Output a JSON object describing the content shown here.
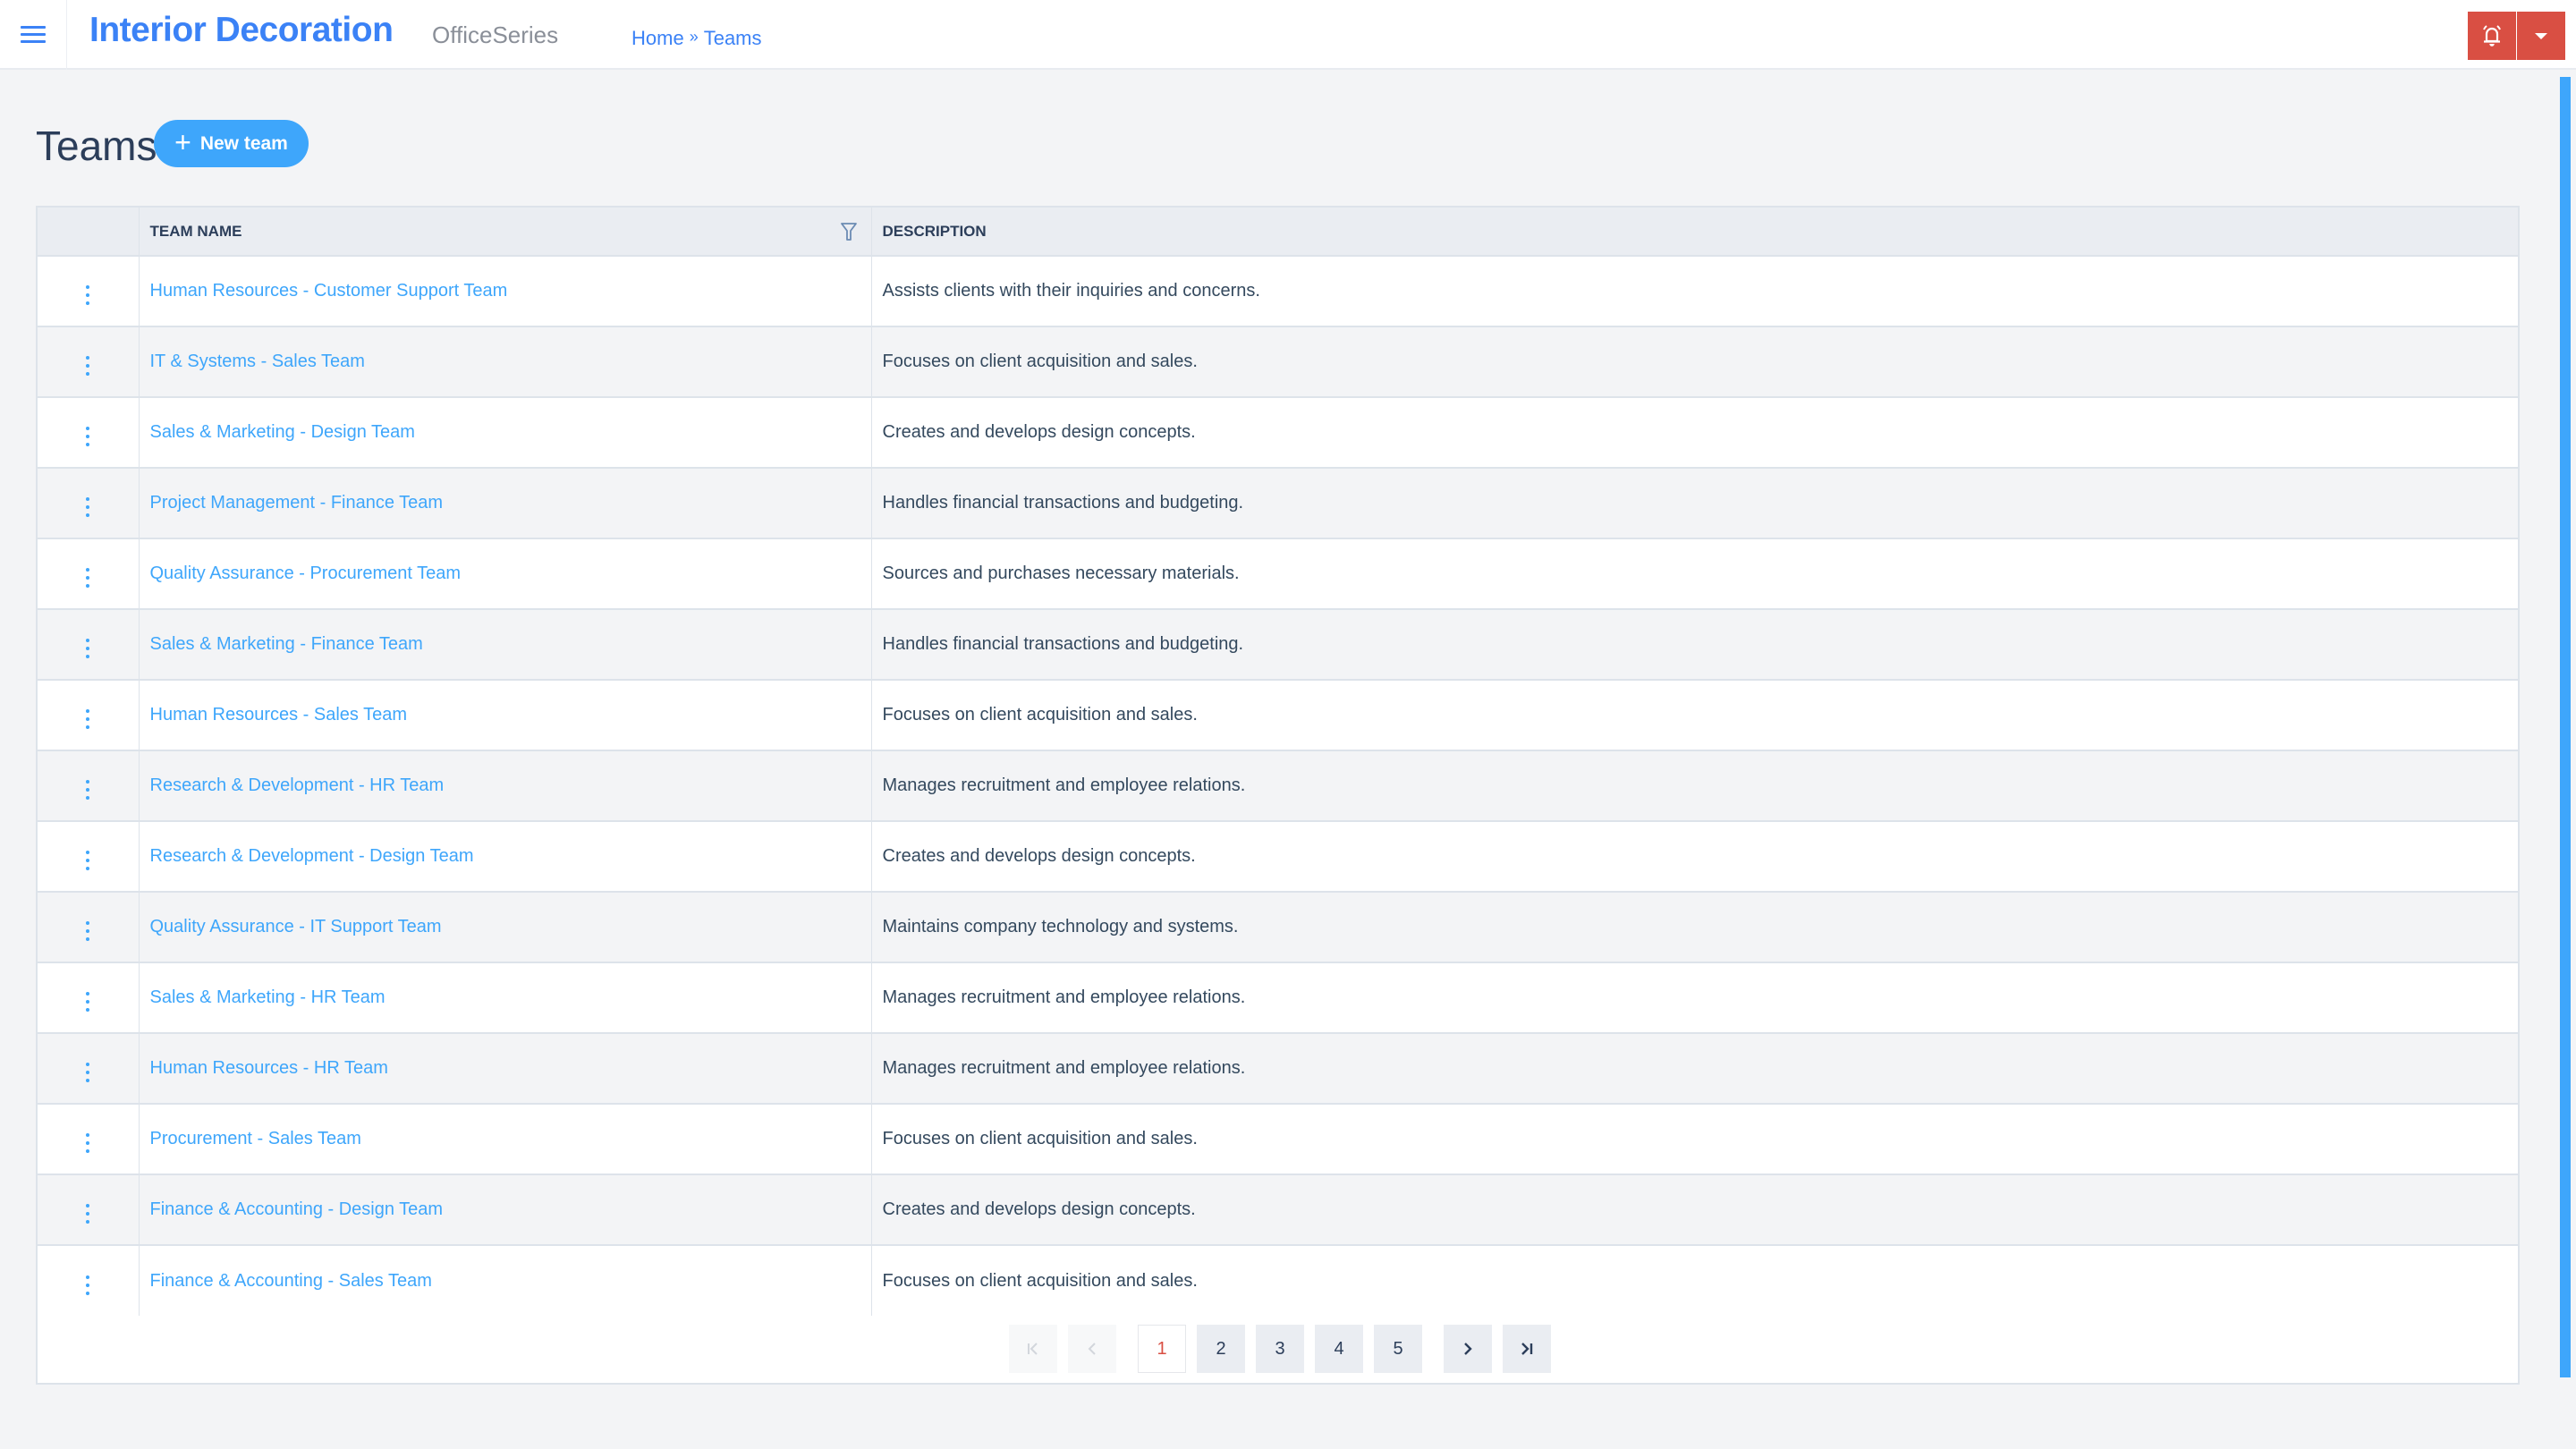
{
  "header": {
    "app_title": "Interior Decoration",
    "app_subtitle": "OfficeSeries",
    "breadcrumb": [
      {
        "label": "Home"
      },
      {
        "label": "Teams"
      }
    ],
    "breadcrumb_separator": "»",
    "icons": {
      "menu": "hamburger-icon",
      "notifications": "bell-icon",
      "dropdown": "caret-down-icon"
    },
    "accent_color": "#3b82f6",
    "alert_color": "#d94f43"
  },
  "page": {
    "title": "Teams",
    "new_button_label": "New team",
    "new_button_icon": "plus-icon"
  },
  "table": {
    "columns": [
      {
        "key": "actions",
        "label": ""
      },
      {
        "key": "name",
        "label": "TEAM NAME",
        "filterable": true
      },
      {
        "key": "description",
        "label": "DESCRIPTION"
      }
    ],
    "rows": [
      {
        "name": "Human Resources - Customer Support Team",
        "description": "Assists clients with their inquiries and concerns."
      },
      {
        "name": "IT & Systems - Sales Team",
        "description": "Focuses on client acquisition and sales."
      },
      {
        "name": "Sales & Marketing - Design Team",
        "description": "Creates and develops design concepts."
      },
      {
        "name": "Project Management - Finance Team",
        "description": "Handles financial transactions and budgeting."
      },
      {
        "name": "Quality Assurance - Procurement Team",
        "description": "Sources and purchases necessary materials."
      },
      {
        "name": "Sales & Marketing - Finance Team",
        "description": "Handles financial transactions and budgeting."
      },
      {
        "name": "Human Resources - Sales Team",
        "description": "Focuses on client acquisition and sales."
      },
      {
        "name": "Research & Development - HR Team",
        "description": "Manages recruitment and employee relations."
      },
      {
        "name": "Research & Development - Design Team",
        "description": "Creates and develops design concepts."
      },
      {
        "name": "Quality Assurance - IT Support Team",
        "description": "Maintains company technology and systems."
      },
      {
        "name": "Sales & Marketing - HR Team",
        "description": "Manages recruitment and employee relations."
      },
      {
        "name": "Human Resources - HR Team",
        "description": "Manages recruitment and employee relations."
      },
      {
        "name": "Procurement - Sales Team",
        "description": "Focuses on client acquisition and sales."
      },
      {
        "name": "Finance & Accounting - Design Team",
        "description": "Creates and develops design concepts."
      },
      {
        "name": "Finance & Accounting - Sales Team",
        "description": "Focuses on client acquisition and sales."
      }
    ]
  },
  "pagination": {
    "current_page": 1,
    "pages": [
      "1",
      "2",
      "3",
      "4",
      "5"
    ],
    "first_icon": "first-page-icon",
    "prev_icon": "chevron-left-icon",
    "next_icon": "chevron-right-icon",
    "last_icon": "last-page-icon",
    "first_disabled": true,
    "prev_disabled": true
  }
}
